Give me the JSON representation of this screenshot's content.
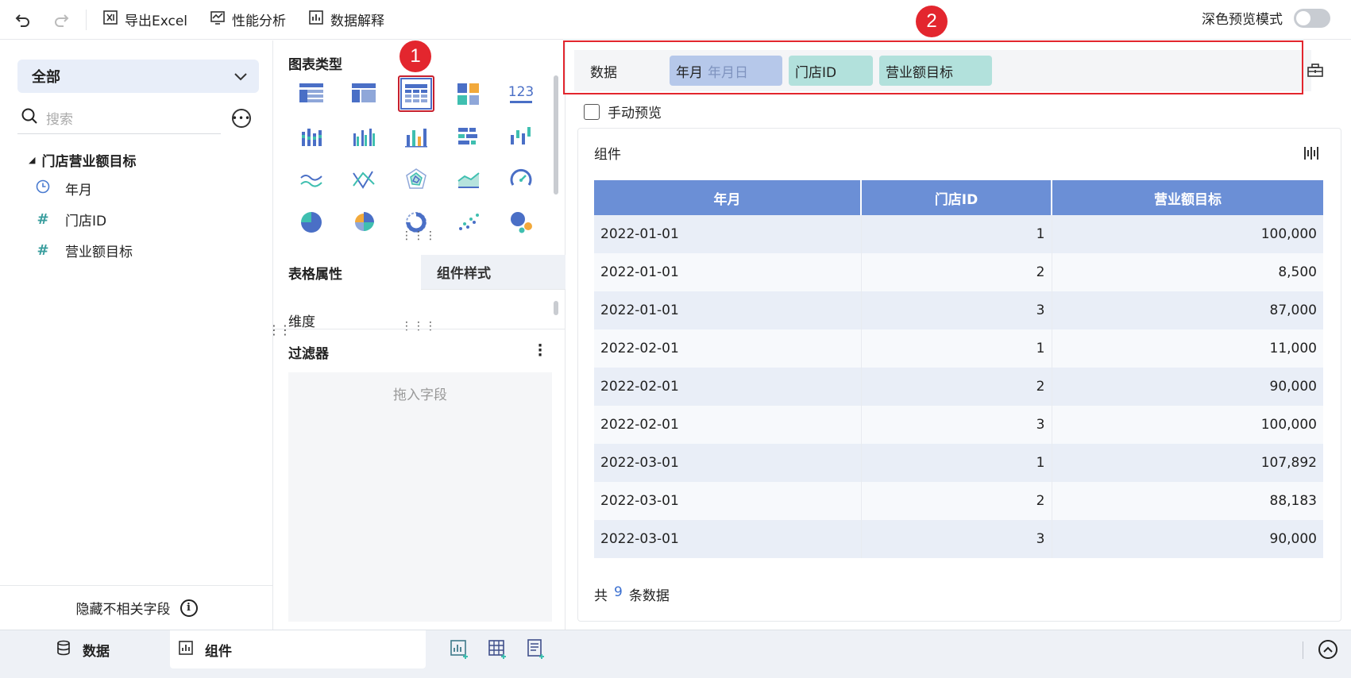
{
  "toolbar": {
    "export_excel": "导出Excel",
    "performance": "性能分析",
    "data_explain": "数据解释",
    "dark_preview": "深色预览模式"
  },
  "left": {
    "dataset": "全部",
    "search_placeholder": "搜索",
    "tree_title": "门店营业额目标",
    "fields": [
      {
        "name": "年月",
        "icon": "clock-icon"
      },
      {
        "name": "门店ID",
        "icon": "hash-icon"
      },
      {
        "name": "营业额目标",
        "icon": "hash-icon"
      }
    ],
    "hide_unrelated": "隐藏不相关字段"
  },
  "mid": {
    "chart_type_label": "图表类型",
    "badge1": "1",
    "tabs": [
      "表格属性",
      "组件样式"
    ],
    "dimension_label": "维度",
    "filter_label": "过滤器",
    "drop_hint": "拖入字段",
    "chart_number_icon": "123"
  },
  "right": {
    "badge2": "2",
    "data_label": "数据",
    "pill_date": "年月",
    "pill_date_sub": "年月日",
    "pill_dim": "门店ID",
    "pill_meas": "营业额目标",
    "manual_preview": "手动预览",
    "card_title": "组件",
    "table": {
      "headers": [
        "年月",
        "门店ID",
        "营业额目标"
      ],
      "rows": [
        [
          "2022-01-01",
          "1",
          "100,000"
        ],
        [
          "2022-01-01",
          "2",
          "8,500"
        ],
        [
          "2022-01-01",
          "3",
          "87,000"
        ],
        [
          "2022-02-01",
          "1",
          "11,000"
        ],
        [
          "2022-02-01",
          "2",
          "90,000"
        ],
        [
          "2022-02-01",
          "3",
          "100,000"
        ],
        [
          "2022-03-01",
          "1",
          "107,892"
        ],
        [
          "2022-03-01",
          "2",
          "88,183"
        ],
        [
          "2022-03-01",
          "3",
          "90,000"
        ]
      ]
    },
    "total_prefix": "共",
    "total_count": "9",
    "total_suffix": "条数据"
  },
  "bottom": {
    "tab_data": "数据",
    "tab_component": "组件"
  },
  "colors": {
    "accent": "#6b8fd6",
    "highlight_red": "#e3262e",
    "date_pill": "#b6c8ea",
    "field_pill": "#b2e1dc"
  }
}
